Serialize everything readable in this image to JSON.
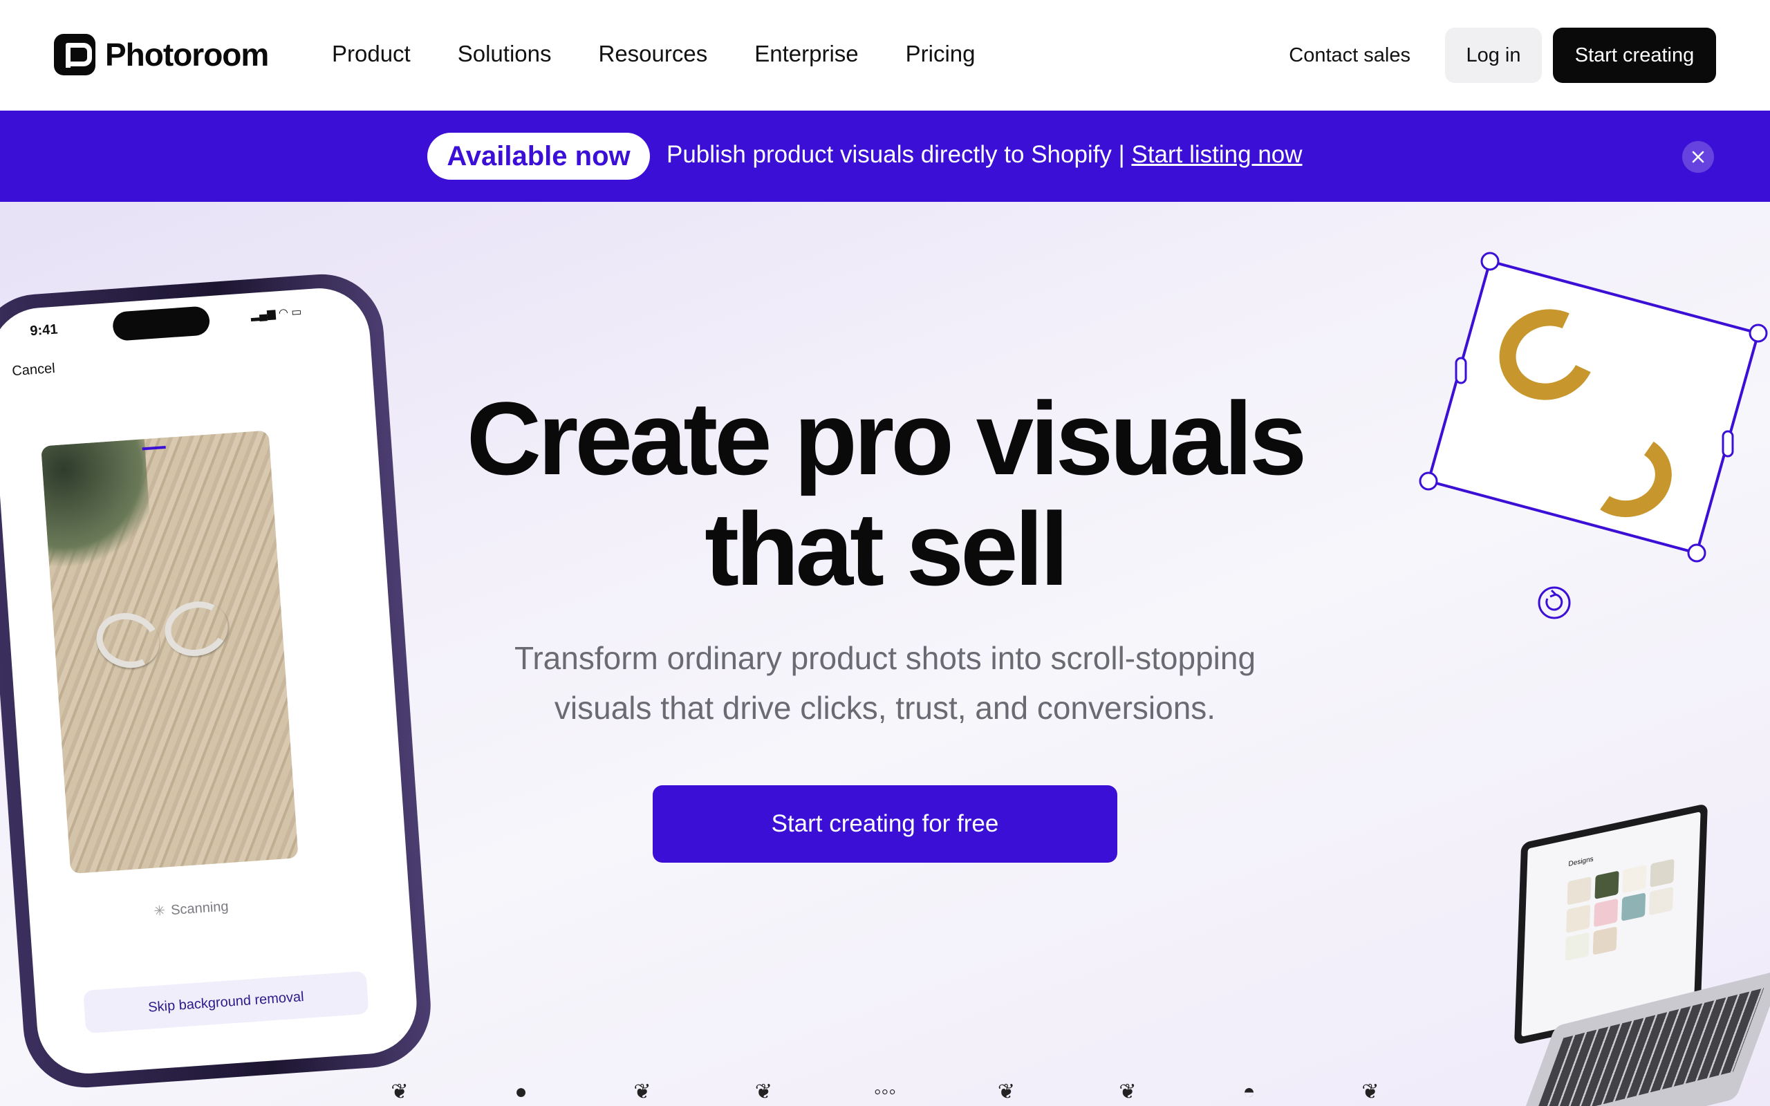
{
  "brand": {
    "name": "Photoroom"
  },
  "nav": {
    "links": [
      "Product",
      "Solutions",
      "Resources",
      "Enterprise",
      "Pricing"
    ],
    "contact_label": "Contact sales",
    "login_label": "Log in",
    "start_label": "Start creating"
  },
  "banner": {
    "pill": "Available now",
    "text": "Publish product visuals directly to Shopify | ",
    "link": "Start listing now",
    "color": "#3b0fd6"
  },
  "hero": {
    "headline_line1": "Create pro visuals",
    "headline_line2": "that sell",
    "subline_line1": "Transform ordinary product shots into scroll-stopping",
    "subline_line2": "visuals that drive clicks, trust, and conversions.",
    "cta_label": "Start creating for free"
  },
  "phone": {
    "time": "9:41",
    "cancel": "Cancel",
    "scanning": "Scanning",
    "skip": "Skip background removal"
  },
  "laptop": {
    "title": "Designs"
  },
  "icons": {
    "close": "close-icon",
    "rotate": "rotate-icon",
    "scan": "spinner-icon"
  },
  "colors": {
    "accent": "#3b0fd6",
    "dark": "#0a0a0a",
    "gold": "#c7962c"
  }
}
